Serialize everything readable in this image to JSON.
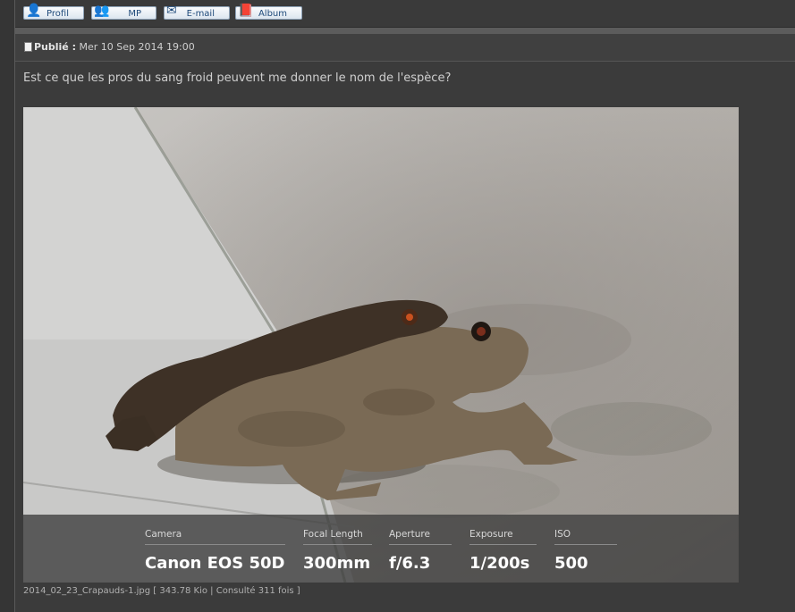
{
  "toolbar": {
    "profil_label": "Profil",
    "mp_label": "MP",
    "email_label": "E-mail",
    "album_label": "Album"
  },
  "post": {
    "published_label": "Publié :",
    "published_date": "Mer 10 Sep 2014 19:00",
    "message": "Est ce que les pros du sang froid peuvent me donner le nom de l'espèce?"
  },
  "photo": {
    "exif": {
      "camera_label": "Camera",
      "camera_value": "Canon EOS 50D",
      "focal_label": "Focal Length",
      "focal_value": "300mm",
      "aperture_label": "Aperture",
      "aperture_value": "f/6.3",
      "exposure_label": "Exposure",
      "exposure_value": "1/200s",
      "iso_label": "ISO",
      "iso_value": "500"
    },
    "caption": "2014_02_23_Crapauds-1.jpg [ 343.78 Kio | Consulté 311 fois ]"
  },
  "colors": {
    "background": "#3b3b3b",
    "button_text": "#1f4a7a",
    "exif_value": "#ffffff"
  }
}
